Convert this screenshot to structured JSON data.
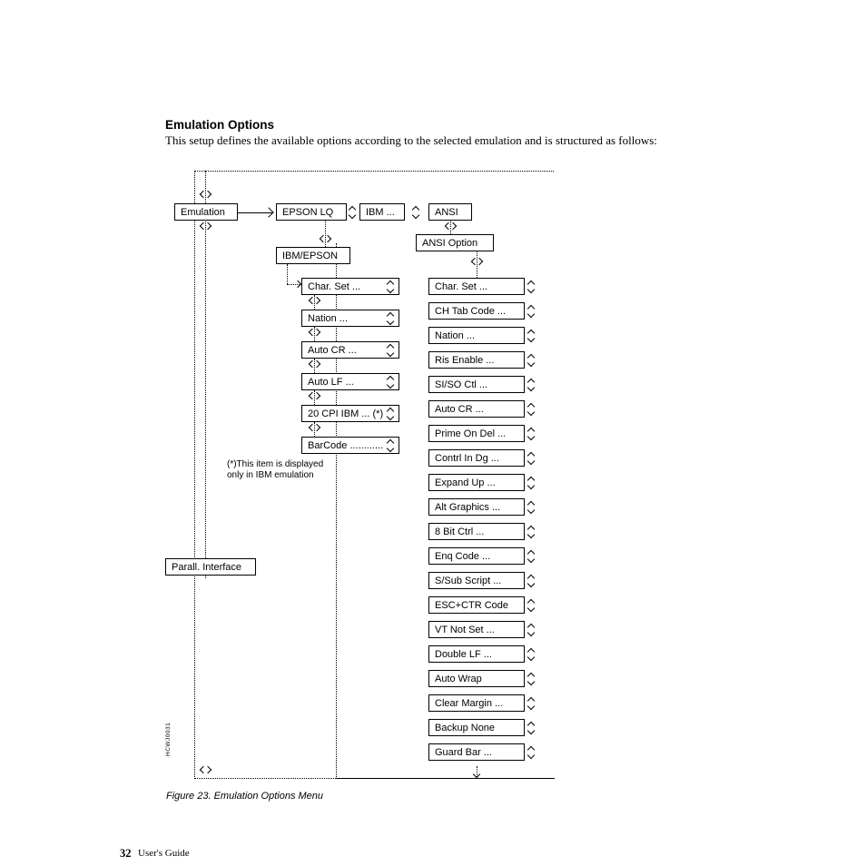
{
  "heading": "Emulation Options",
  "intro": "This setup defines the available options according to the selected emulation and is structured as follows:",
  "caption": "Figure 23. Emulation Options Menu",
  "page_number": "32",
  "footer_guide": "User's Guide",
  "side_code": "HCWJ0031",
  "footnote1": "(*)This item is displayed",
  "footnote2": "only in IBM emulation",
  "boxes": {
    "emulation": "Emulation",
    "epson_lq": "EPSON LQ",
    "ibm": "IBM ...",
    "ansi": "ANSI",
    "ansi_option": "ANSI Option",
    "ibm_epson": "IBM/EPSON",
    "parall": "Parall. Interface"
  },
  "ibm_items": [
    "Char. Set ...",
    "Nation ...",
    "Auto CR ...",
    "Auto LF ...",
    "20 CPI IBM ... (*)",
    "BarCode ............"
  ],
  "ansi_items": [
    "Char. Set ...",
    "CH Tab Code ...",
    "Nation ...",
    "Ris Enable ...",
    "SI/SO Ctl ...",
    "Auto CR ...",
    "Prime On Del ...",
    "Contrl In Dg ...",
    "Expand Up ...",
    "Alt Graphics ...",
    "8 Bit Ctrl ...",
    "Enq Code ...",
    "S/Sub Script ...",
    "ESC+CTR Code",
    "VT Not Set ...",
    "Double LF ...",
    "Auto Wrap",
    "Clear Margin ...",
    "Backup None",
    "Guard Bar ..."
  ]
}
